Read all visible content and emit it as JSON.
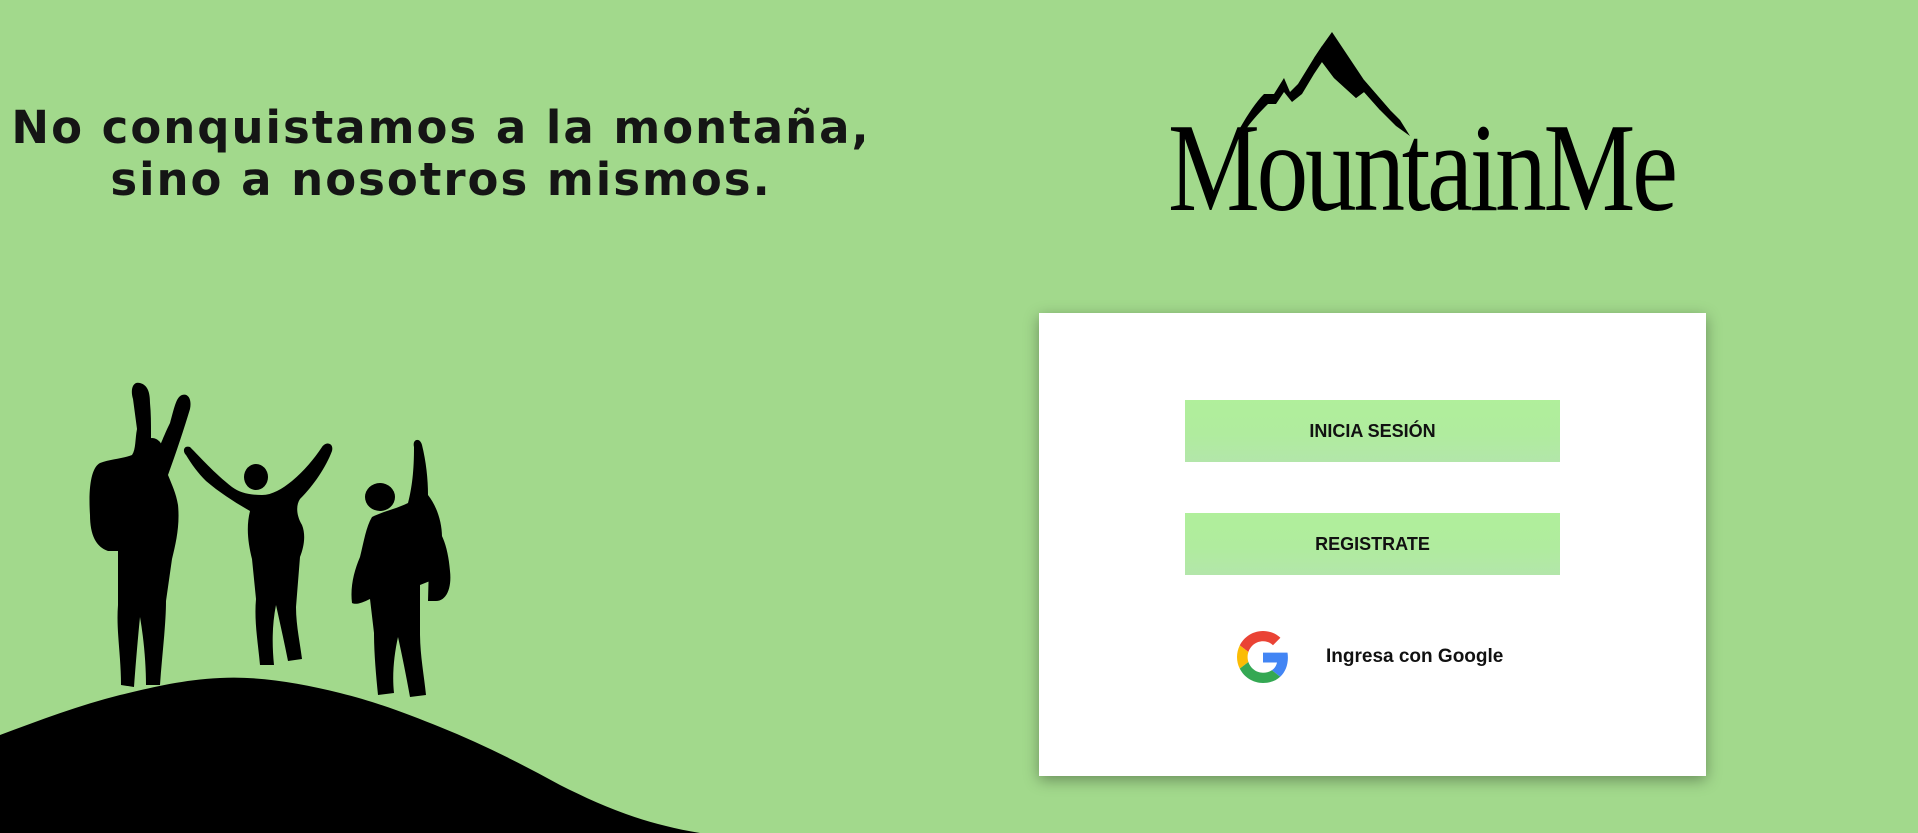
{
  "tagline": {
    "line1": "No conquistamos a la montaña,",
    "line2": "sino a nosotros mismos."
  },
  "brand": {
    "name": "MountainMe",
    "icon": "mountain-peak-icon"
  },
  "illustration": {
    "icon": "hikers-silhouette"
  },
  "card": {
    "login_label": "INICIA SESIÓN",
    "register_label": "REGISTRATE",
    "google_label": "Ingresa con Google",
    "google_icon": "google-logo-icon"
  },
  "colors": {
    "background": "#a2d98c",
    "button": "#b0ec9e",
    "card": "#ffffff"
  }
}
